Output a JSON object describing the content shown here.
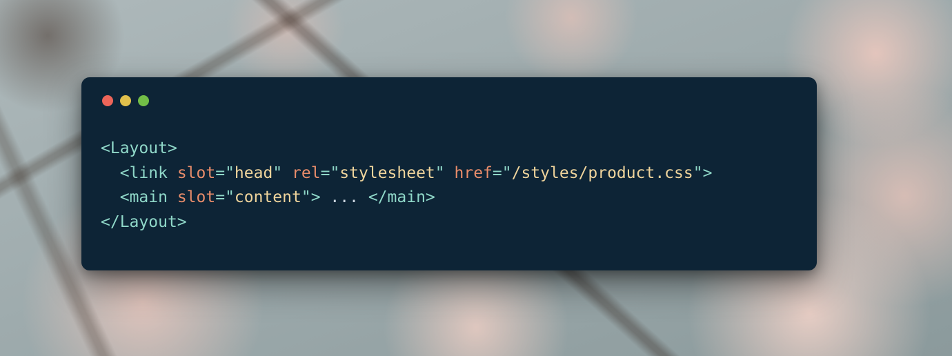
{
  "traffic": {
    "red": "#ed6559",
    "yellow": "#e1c04c",
    "green": "#72be47"
  },
  "code": {
    "l1": {
      "open": "<",
      "tag": "Layout",
      "close": ">"
    },
    "l2": {
      "indent": "  ",
      "open": "<",
      "tag": "link",
      "sp": " ",
      "a1": "slot",
      "eq": "=",
      "q": "\"",
      "v1": "head",
      "a2": "rel",
      "v2": "stylesheet",
      "a3": "href",
      "v3": "/styles/product.css",
      "close": ">"
    },
    "l3": {
      "indent": "  ",
      "open": "<",
      "tag": "main",
      "sp": " ",
      "a1": "slot",
      "eq": "=",
      "q": "\"",
      "v1": "content",
      "closeOpen": ">",
      "text": " ... ",
      "openEnd": "</",
      "closeEnd": ">"
    },
    "l4": {
      "open": "</",
      "tag": "Layout",
      "close": ">"
    }
  }
}
